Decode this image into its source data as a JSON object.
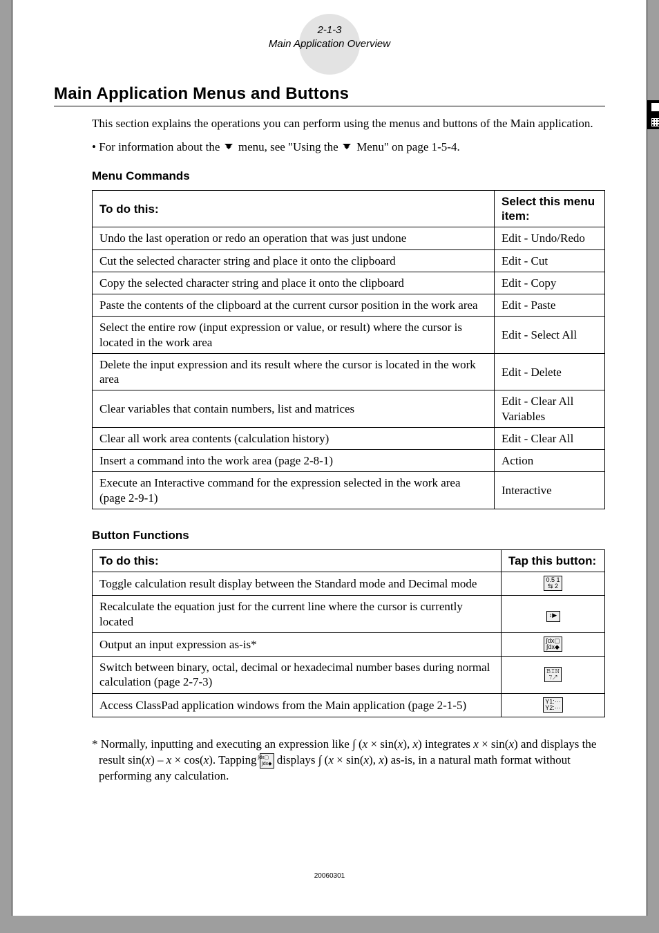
{
  "header": {
    "pagenum": "2-1-3",
    "subtitle": "Main Application Overview"
  },
  "heading": "Main Application Menus and Buttons",
  "intro": "This section explains the operations you can perform using the menus and buttons of the Main application.",
  "bullet_pre": "For information about the ",
  "bullet_mid": " menu, see \"Using the ",
  "bullet_post": " Menu\" on page 1-5-4.",
  "menu_label": "Menu Commands",
  "menu_table": {
    "th1": "To do this:",
    "th2": "Select this menu item:",
    "rows": [
      {
        "a": "Undo the last operation or redo an operation that was just undone",
        "b": "Edit - Undo/Redo"
      },
      {
        "a": "Cut the selected character string and place it onto the clipboard",
        "b": "Edit - Cut"
      },
      {
        "a": "Copy the selected character string and place it onto the clipboard",
        "b": "Edit - Copy"
      },
      {
        "a": "Paste the contents of the clipboard at the current cursor position in the work area",
        "b": "Edit - Paste"
      },
      {
        "a": "Select the entire row (input expression or value, or result) where the cursor is located in the work area",
        "b": "Edit - Select All"
      },
      {
        "a": "Delete the input expression and its result where the cursor is located in the work area",
        "b": "Edit - Delete"
      },
      {
        "a": "Clear variables that contain numbers, list and matrices",
        "b": "Edit - Clear All Variables"
      },
      {
        "a": "Clear all work area contents (calculation history)",
        "b": "Edit - Clear All"
      },
      {
        "a": "Insert a command into the work area (page 2-8-1)",
        "b": "Action"
      },
      {
        "a": "Execute an Interactive command for the expression selected in the work area (page 2-9-1)",
        "b": "Interactive"
      }
    ]
  },
  "button_label": "Button Functions",
  "button_table": {
    "th1": "To do this:",
    "th2": "Tap this button:",
    "rows": [
      {
        "a": "Toggle calculation result display between the Standard mode and Decimal mode",
        "icon": "standard-decimal-icon"
      },
      {
        "a": "Recalculate the equation just for the current line where the cursor is currently located",
        "icon": "recalc-icon"
      },
      {
        "a": "Output an input expression as-is*",
        "icon": "asis-icon"
      },
      {
        "a": "Switch between binary, octal, decimal or hexadecimal number bases during normal calculation (page 2-7-3)",
        "icon": "base-icon"
      },
      {
        "a": "Access ClassPad application windows from the Main application (page 2-1-5)",
        "icon": "y1y2-icon"
      }
    ]
  },
  "footnote_parts": {
    "p1": "* Normally, inputting and executing an expression like ∫ (",
    "p2": " × sin(",
    "p3": "), ",
    "p4": ") integrates ",
    "p5": " × sin(",
    "p6": ") and displays the result sin(",
    "p7": ") – ",
    "p8": " × cos(",
    "p9": "). Tapping ",
    "p10": " displays ∫ (",
    "p11": " × sin(",
    "p12": "), ",
    "p13": ") as-is, in a natural math format without performing any calculation."
  },
  "x": "x",
  "footer_id": "20060301",
  "icons": {
    "standard-decimal-icon": "0.5 1\n⇆ 2",
    "recalc-icon": "↕▶",
    "asis-icon": "∫dx▢\n∫dx◆",
    "base-icon": "𝙱𝙸𝙽\n𝟽↗",
    "y1y2-icon": "Y1:···\nY2:···"
  }
}
